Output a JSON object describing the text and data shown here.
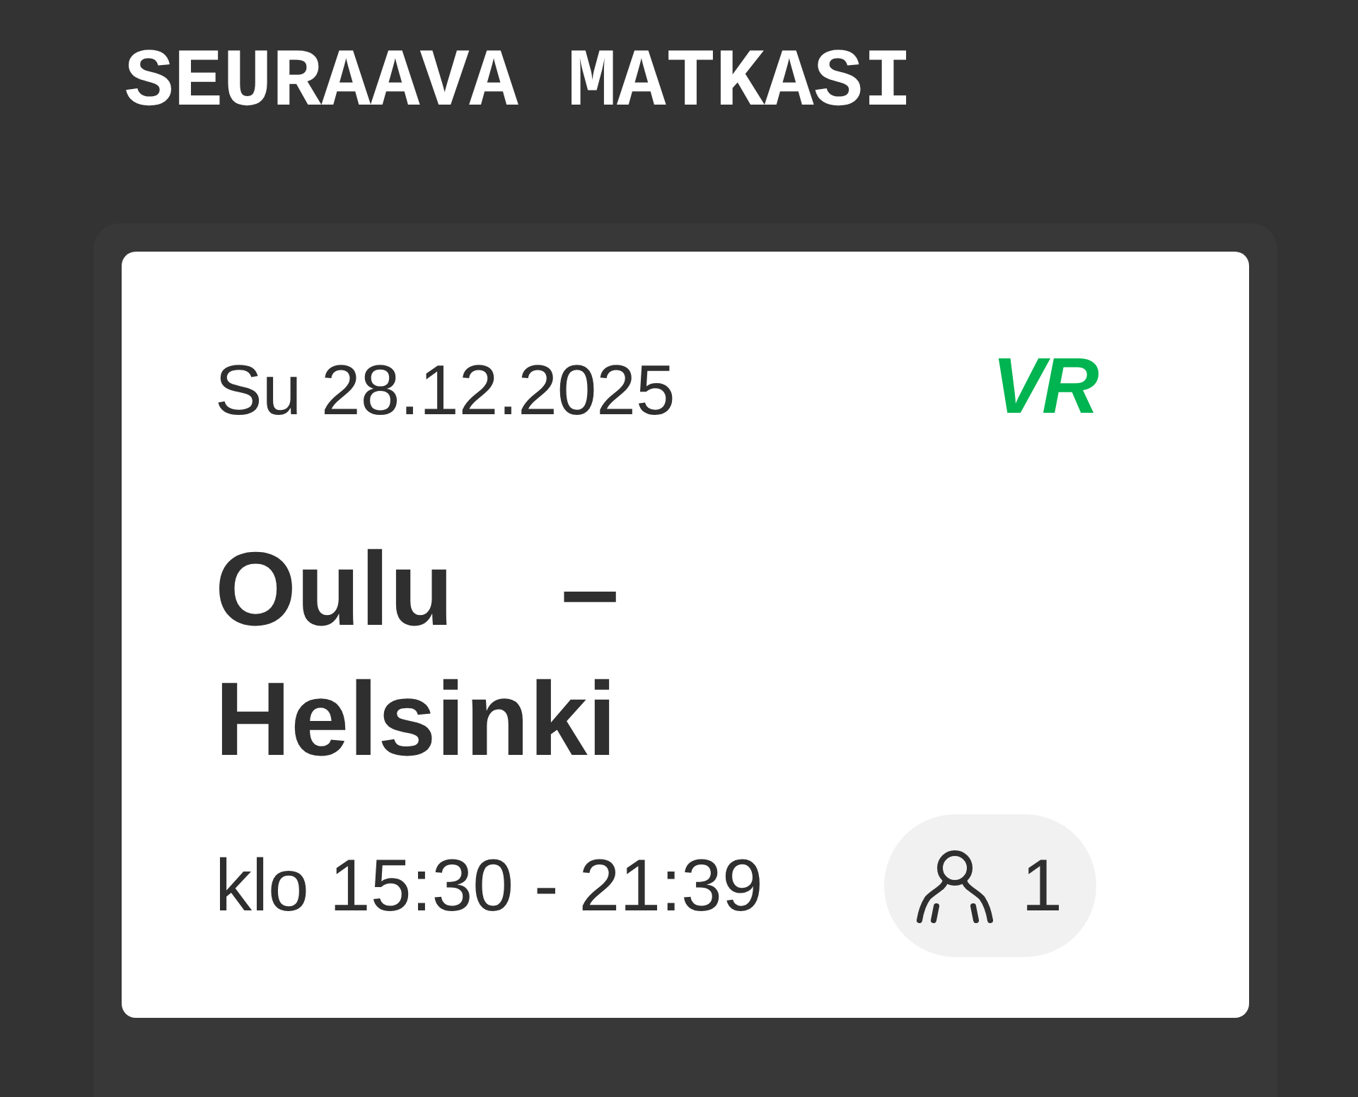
{
  "heading": "SEURAAVA MATKASI",
  "trip_card": {
    "date": "Su 28.12.2025",
    "logo": "VR",
    "route": {
      "from": "Oulu",
      "separator": "–",
      "to": "Helsinki"
    },
    "time": "klo 15:30 - 21:39",
    "passengers": "1"
  }
}
